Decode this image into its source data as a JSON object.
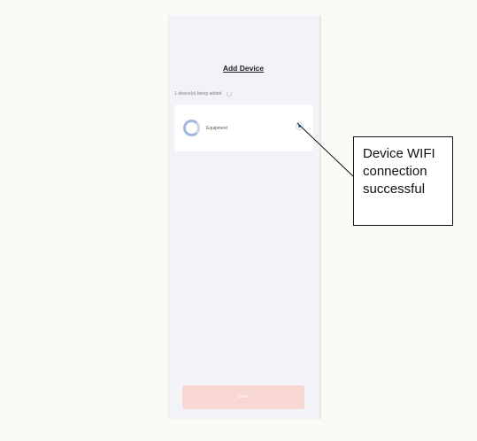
{
  "screen": {
    "title": "Add Device",
    "adding_status": "1 device(s) being added",
    "device": {
      "name": "Equipment",
      "icon": "device-ring-icon",
      "status_icon": "connected-dot-icon"
    },
    "done_button": {
      "label": "Done"
    }
  },
  "annotation": {
    "text": "Device WIFI\nconnection\nsuccessful"
  },
  "colors": {
    "screen_bg": "#f2f3f7",
    "accent_blue": "#2f66c8",
    "done_button_bg": "#f8d6d2"
  }
}
